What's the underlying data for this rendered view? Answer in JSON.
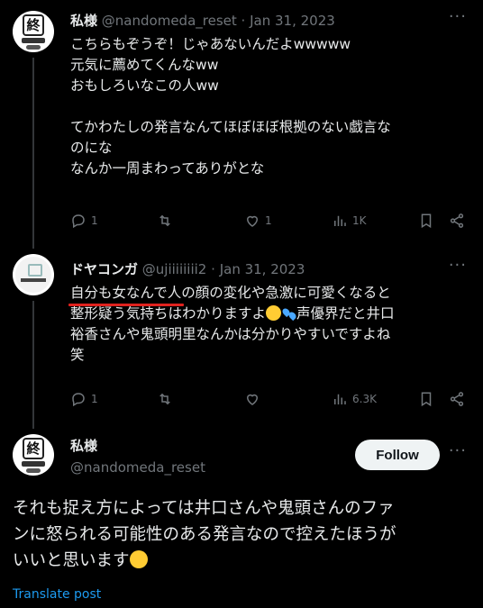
{
  "tweets": [
    {
      "display_name": "私様",
      "handle": "@nandomeda_reset",
      "separator": "·",
      "date": "Jan 31, 2023",
      "lines": [
        "こちらもぞうぞ！じゃあないんだよwwwww",
        "元気に薦めてくんなww",
        "おもしろいなこの人ww",
        "",
        "てかわたしの発言なんてほぼほぼ根拠のない戯言な",
        "のにな",
        "なんか一周まわってありがとな"
      ],
      "replies": "1",
      "retweets": "",
      "likes": "1",
      "views": "1K"
    },
    {
      "display_name": "ドヤコンガ",
      "handle": "@ujiiiiiiii2",
      "separator": "·",
      "date": "Jan 31, 2023",
      "lines": [
        "自分も女なんで人の顔の変化や急激に可愛くなると",
        "整形疑う気持ちはわかりますよ",
        "声優界だと井口",
        "裕香さんや鬼頭明里なんかは分かりやすいですよね",
        "笑"
      ],
      "replies": "1",
      "retweets": "",
      "likes": "",
      "views": "6.3K"
    }
  ],
  "main_tweet": {
    "display_name": "私様",
    "handle": "@nandomeda_reset",
    "follow_label": "Follow",
    "lines": [
      "それも捉え方によっては井口さんや鬼頭さんのファ",
      "ンに怒られる可能性のある発言なので控えたほうが",
      "いいと思います"
    ],
    "translate_label": "Translate post"
  },
  "icons": [
    "more-icon",
    "reply-icon",
    "retweet-icon",
    "like-icon",
    "views-icon",
    "bookmark-icon",
    "share-icon",
    "laughing-emoji",
    "sweat-drops-emoji"
  ],
  "colors": {
    "background": "#000000",
    "text": "#e7e9ea",
    "secondary": "#71767b",
    "link": "#1d9bf0",
    "annotation": "#e0221e"
  }
}
